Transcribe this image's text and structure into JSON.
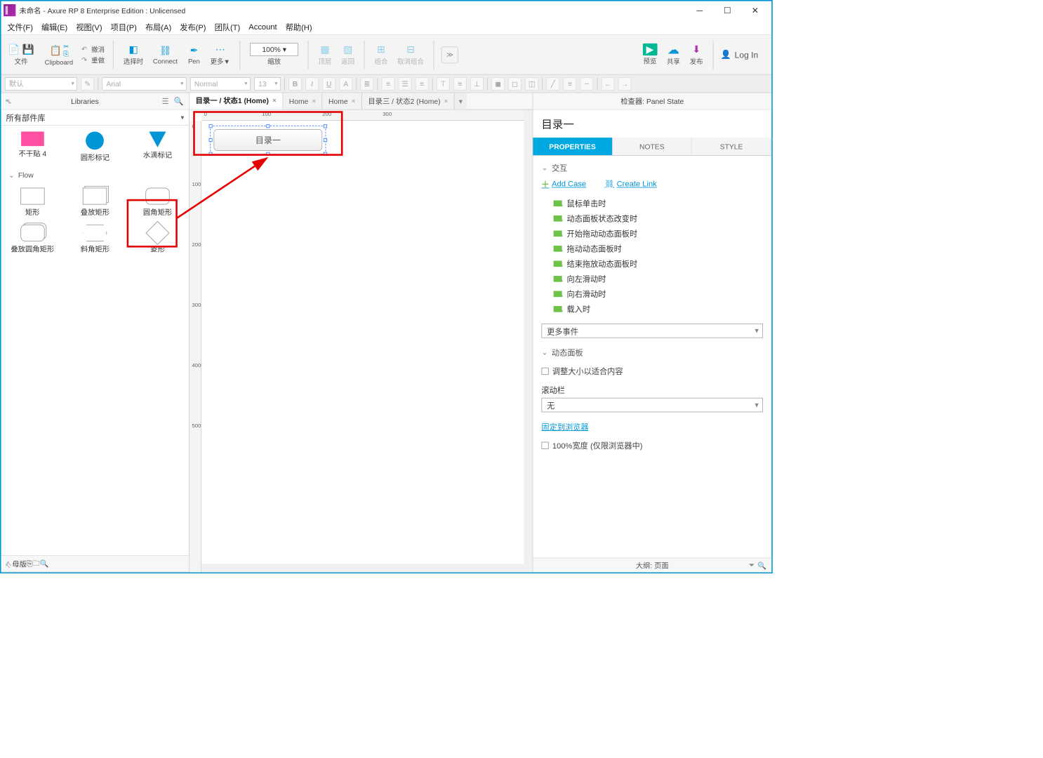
{
  "titlebar": {
    "text": "未命名 - Axure RP 8 Enterprise Edition : Unlicensed"
  },
  "menubar": [
    "文件(F)",
    "编辑(E)",
    "视图(V)",
    "项目(P)",
    "布局(A)",
    "发布(P)",
    "团队(T)",
    "Account",
    "帮助(H)"
  ],
  "toolbar": {
    "file": "文件",
    "clipboard": "Clipboard",
    "undo": "撤消",
    "redo": "重做",
    "select": "选择时",
    "connect": "Connect",
    "pen": "Pen",
    "more": "更多▼",
    "zoom_value": "100%",
    "zoom_label": "缩放",
    "front": "顶层",
    "back": "返回",
    "group": "组合",
    "ungroup": "取消组合",
    "preview": "预览",
    "share": "共享",
    "publish": "发布",
    "login": "Log In"
  },
  "toolbar2": {
    "style_combo": "默认",
    "font": "Arial",
    "weight": "Normal",
    "size": "13"
  },
  "left": {
    "panel_title": "Libraries",
    "library_select": "所有部件库",
    "row1": [
      {
        "label": "不干贴 4"
      },
      {
        "label": "圆形标记"
      },
      {
        "label": "水滴标记"
      }
    ],
    "section": "Flow",
    "row2": [
      {
        "label": "矩形"
      },
      {
        "label": "叠放矩形"
      },
      {
        "label": "圆角矩形"
      }
    ],
    "row3": [
      {
        "label": "叠放圆角矩形"
      },
      {
        "label": "斜角矩形"
      },
      {
        "label": "菱形"
      }
    ],
    "masters": "母版"
  },
  "tabs": [
    {
      "label": "目录一 / 状态1 (Home)",
      "active": true
    },
    {
      "label": "Home"
    },
    {
      "label": "Home"
    },
    {
      "label": "目录三 / 状态2 (Home)"
    }
  ],
  "canvas": {
    "selected_text": "目录一",
    "ruler_h": [
      "0",
      "100",
      "200",
      "300"
    ],
    "ruler_v": [
      "0",
      "100",
      "200",
      "300",
      "400",
      "500"
    ]
  },
  "inspector": {
    "header": "检查器: Panel State",
    "name": "目录一",
    "tabs": {
      "properties": "PROPERTIES",
      "notes": "NOTES",
      "style": "STYLE"
    },
    "sec_interaction": "交互",
    "add_case": "Add Case",
    "create_link": "Create Link",
    "events": [
      "鼠标单击时",
      "动态面板状态改变时",
      "开始拖动动态面板时",
      "拖动动态面板时",
      "结束拖放动态面板时",
      "向左滑动时",
      "向右滑动时",
      "载入时"
    ],
    "more_events": "更多事件",
    "sec_dp": "动态面板",
    "fit": "调整大小以适合内容",
    "scroll_label": "滚动栏",
    "scroll_value": "无",
    "pin": "固定到浏览器",
    "width100": "100%宽度 (仅限浏览器中)"
  },
  "outline": "大纲: 页面"
}
